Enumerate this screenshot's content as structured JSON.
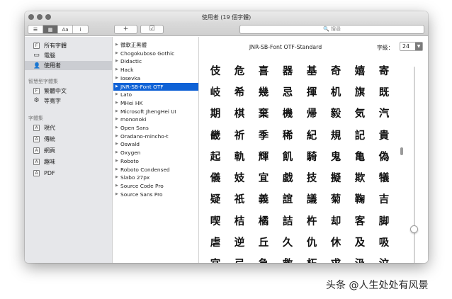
{
  "window": {
    "title": "使用者 (19 個字體)"
  },
  "toolbar": {
    "view_buttons": [
      "☰",
      "▦",
      "Aa",
      "i"
    ],
    "add_label": "+",
    "check_label": "☑",
    "search_placeholder": "🔍 搜尋"
  },
  "sidebar": {
    "items": [
      {
        "label": "所有字體",
        "icon": "font-icon",
        "glyph": "F"
      },
      {
        "label": "電腦",
        "icon": "computer-icon",
        "glyph": "▭"
      },
      {
        "label": "使用者",
        "icon": "user-icon",
        "glyph": "👤"
      }
    ],
    "smart_header": "智慧型字體集",
    "smart_items": [
      {
        "label": "繁體中文",
        "icon": "font-icon",
        "glyph": "F"
      },
      {
        "label": "等寬字",
        "icon": "gear-icon",
        "glyph": "⚙"
      }
    ],
    "collections_header": "字體集",
    "collections": [
      {
        "label": "現代",
        "glyph": "A"
      },
      {
        "label": "傳統",
        "glyph": "A"
      },
      {
        "label": "網頁",
        "glyph": "A"
      },
      {
        "label": "趣味",
        "glyph": "A"
      },
      {
        "label": "PDF",
        "glyph": "A"
      }
    ],
    "add_label": "+"
  },
  "fontlist": {
    "items": [
      "微軟正黑體",
      "Chogokuboso Gothic",
      "Didactic",
      "Hack",
      "Iosevka",
      "JNR-SB-Font OTF",
      "Lato",
      "MHei HK",
      "Microsoft JhengHei UI",
      "mononoki",
      "Open Sans",
      "Oradano-mincho-t",
      "Oswald",
      "Oxygen",
      "Roboto",
      "Roboto Condensed",
      "Slabo 27px",
      "Source Code Pro",
      "Source Sans Pro"
    ],
    "selected": 5
  },
  "preview": {
    "font_title": "JNR-SB-Font OTF-Standard",
    "size_label": "字級：",
    "size_value": "24",
    "glyphs": [
      "伎",
      "危",
      "喜",
      "器",
      "基",
      "奇",
      "嬉",
      "寄",
      "岐",
      "希",
      "幾",
      "忌",
      "揮",
      "机",
      "旗",
      "既",
      "期",
      "棋",
      "棄",
      "機",
      "帰",
      "毅",
      "気",
      "汽",
      "畿",
      "祈",
      "季",
      "稀",
      "紀",
      "規",
      "記",
      "貴",
      "起",
      "軌",
      "輝",
      "飢",
      "騎",
      "鬼",
      "亀",
      "偽",
      "儀",
      "妓",
      "宜",
      "戯",
      "技",
      "擬",
      "欺",
      "犠",
      "疑",
      "祇",
      "義",
      "誼",
      "議",
      "菊",
      "鞠",
      "吉",
      "喫",
      "桔",
      "橘",
      "詰",
      "杵",
      "却",
      "客",
      "脚",
      "虐",
      "逆",
      "丘",
      "久",
      "仇",
      "休",
      "及",
      "吸",
      "宮",
      "弓",
      "急",
      "救",
      "朽",
      "求",
      "汲",
      "泣"
    ]
  },
  "watermark": "头条 @人生处处有风景"
}
